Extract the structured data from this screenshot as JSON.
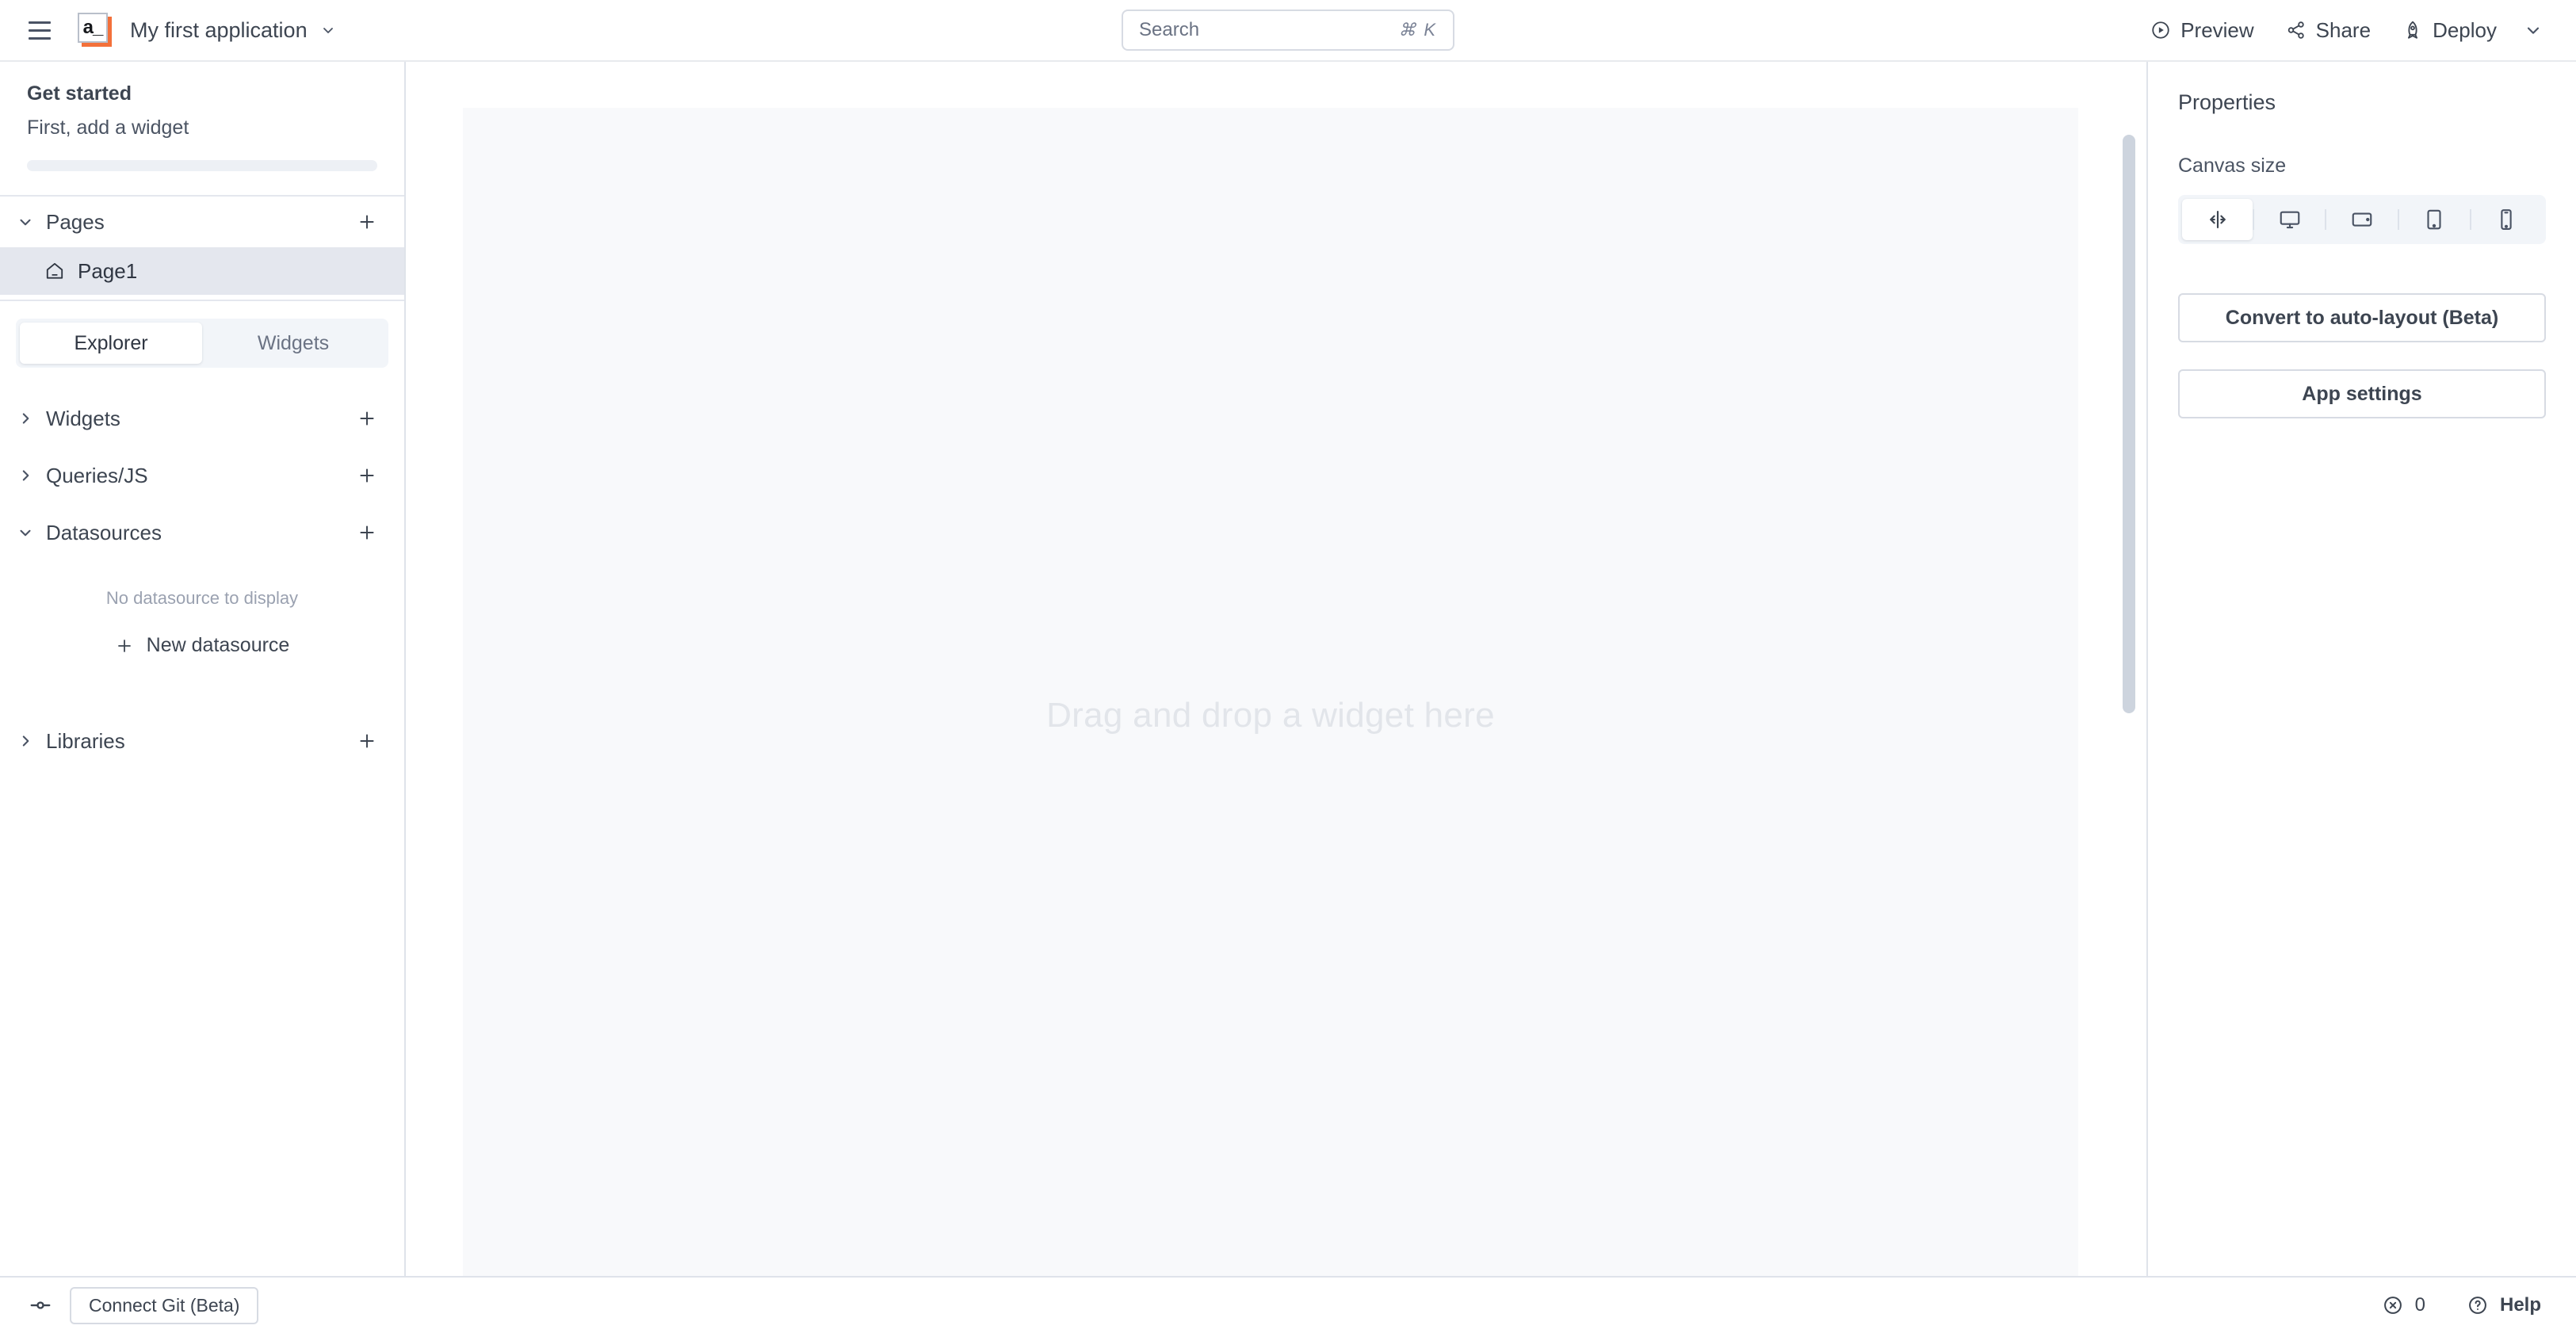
{
  "topbar": {
    "menu_icon": "hamburger-icon",
    "logo_text": "a_",
    "app_title": "My first application",
    "app_title_caret": "chevron-down-icon",
    "search": {
      "placeholder": "Search",
      "shortcut": "⌘ K"
    },
    "actions": [
      {
        "label": "Preview",
        "icon": "play-circle-icon"
      },
      {
        "label": "Share",
        "icon": "share-nodes-icon"
      },
      {
        "label": "Deploy",
        "icon": "rocket-icon"
      }
    ],
    "deploy_caret": "chevron-down-icon"
  },
  "sidebar": {
    "get_started": {
      "title": "Get started",
      "subtitle": "First, add a widget",
      "progress_percent": 0
    },
    "pages": {
      "label": "Pages",
      "chevron": "chevron-down-icon",
      "add_icon": "plus-icon",
      "items": [
        {
          "label": "Page1",
          "icon": "home-icon",
          "selected": true
        }
      ]
    },
    "tabs": [
      {
        "label": "Explorer",
        "active": true
      },
      {
        "label": "Widgets",
        "active": false
      }
    ],
    "explorer_sections": [
      {
        "label": "Widgets",
        "chevron": "chevron-right-icon",
        "add_icon": "plus-icon",
        "expanded": false
      },
      {
        "label": "Queries/JS",
        "chevron": "chevron-right-icon",
        "add_icon": "plus-icon",
        "expanded": false
      },
      {
        "label": "Datasources",
        "chevron": "chevron-down-icon",
        "add_icon": "plus-icon",
        "expanded": true
      },
      {
        "label": "Libraries",
        "chevron": "chevron-right-icon",
        "add_icon": "plus-icon",
        "expanded": false
      }
    ],
    "datasources": {
      "empty_text": "No datasource to display",
      "new_label": "New datasource",
      "new_icon": "plus-icon"
    },
    "git": {
      "label": "Connect Git (Beta)",
      "icon": "git-commit-icon"
    }
  },
  "canvas": {
    "hint": "Drag and drop a widget here"
  },
  "properties": {
    "title": "Properties",
    "canvas_size_label": "Canvas size",
    "canvas_sizes": [
      {
        "name": "fluid",
        "icon": "resize-horizontal-icon",
        "active": true
      },
      {
        "name": "desktop",
        "icon": "desktop-icon",
        "active": false
      },
      {
        "name": "tablet-landscape",
        "icon": "tablet-landscape-icon",
        "active": false
      },
      {
        "name": "tablet-portrait",
        "icon": "tablet-portrait-icon",
        "active": false
      },
      {
        "name": "mobile",
        "icon": "mobile-icon",
        "active": false
      }
    ],
    "buttons": [
      {
        "label": "Convert to auto-layout (Beta)",
        "name": "convert-auto-layout"
      },
      {
        "label": "App settings",
        "name": "app-settings"
      }
    ]
  },
  "statusbar": {
    "errors": {
      "count": "0",
      "icon": "error-circle-icon"
    },
    "help": {
      "label": "Help",
      "icon": "question-circle-icon"
    }
  },
  "colors": {
    "brand_orange": "#f3703a",
    "text_primary": "#3d4551",
    "border": "#dfe3ea",
    "canvas_bg": "#f8f9fb",
    "selected_row": "#e4e7ee"
  }
}
